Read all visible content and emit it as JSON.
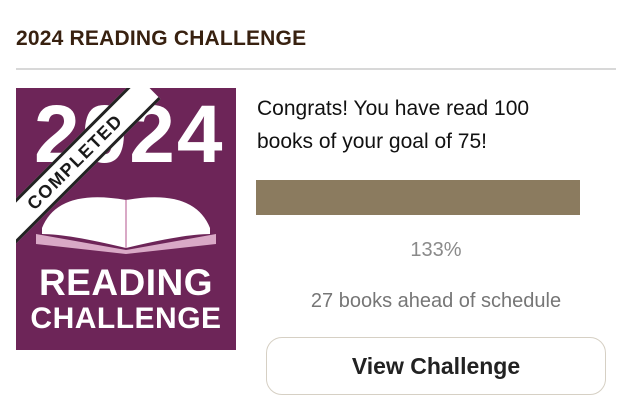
{
  "header": {
    "title": "2024 READING CHALLENGE"
  },
  "badge": {
    "year": "2024",
    "ribbon_text": "COMPLETED",
    "line1": "READING",
    "line2": "CHALLENGE",
    "icon": "open-book-icon",
    "background_color": "#6d2558"
  },
  "progress": {
    "message": "Congrats! You have read 100 books of your goal of 75!",
    "books_read": 100,
    "goal": 75,
    "fill_fraction": 1.0,
    "percent_label": "133%",
    "schedule_text": "27 books ahead of schedule",
    "fill_color": "#8b7b5f"
  },
  "actions": {
    "view_label": "View Challenge"
  }
}
